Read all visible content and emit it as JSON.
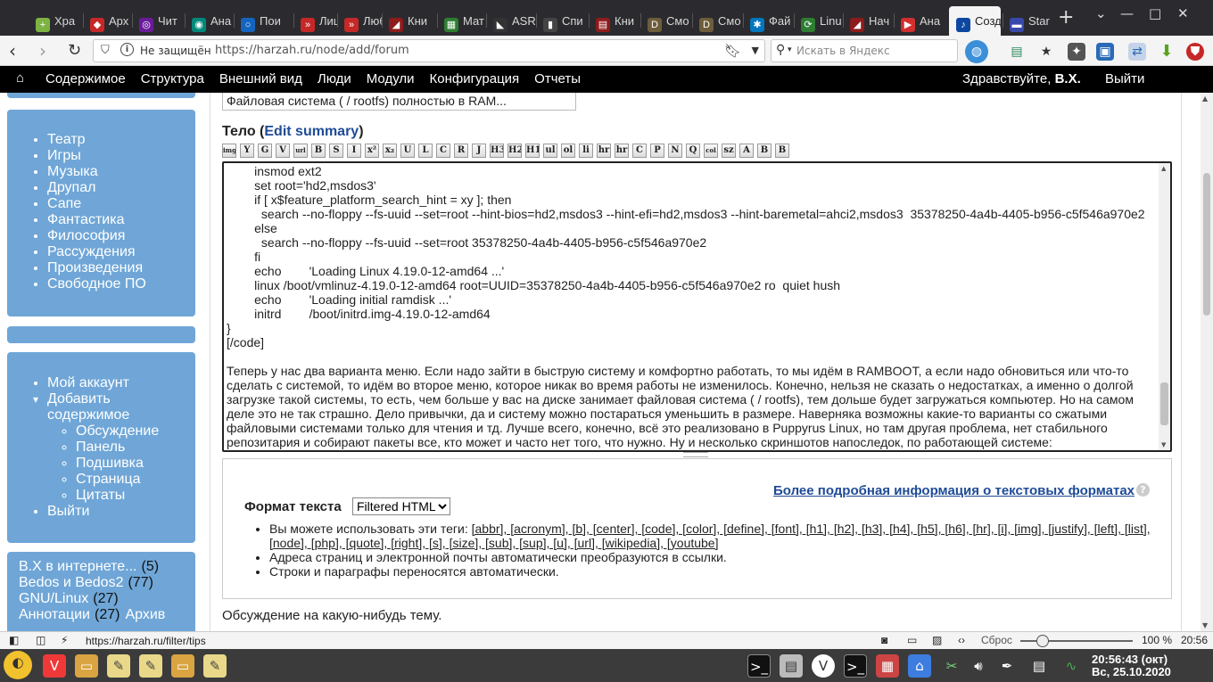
{
  "browser": {
    "tabs": [
      {
        "label": "Хра",
        "color": "#7cb342",
        "glyph": "+"
      },
      {
        "label": "Арх",
        "color": "#c62828",
        "glyph": "◆"
      },
      {
        "label": "Чит",
        "color": "#6a1b9a",
        "glyph": "◎"
      },
      {
        "label": "Ана",
        "color": "#00897b",
        "glyph": "◉"
      },
      {
        "label": "Пои",
        "color": "#1565c0",
        "glyph": "○"
      },
      {
        "label": "Лиц",
        "color": "#c62828",
        "glyph": "»"
      },
      {
        "label": "Люб",
        "color": "#c62828",
        "glyph": "»"
      },
      {
        "label": "Кни",
        "color": "#8e1b1b",
        "glyph": "◢"
      },
      {
        "label": "Мат",
        "color": "#2e7d32",
        "glyph": "▦"
      },
      {
        "label": "ASR",
        "color": "#333333",
        "glyph": "◣"
      },
      {
        "label": "Спи",
        "color": "#444444",
        "glyph": "▮"
      },
      {
        "label": "Кни",
        "color": "#8e1b1b",
        "glyph": "▤"
      },
      {
        "label": "Смо",
        "color": "#6d5d3a",
        "glyph": "D"
      },
      {
        "label": "Смо",
        "color": "#6d5d3a",
        "glyph": "D"
      },
      {
        "label": "Фай",
        "color": "#0277bd",
        "glyph": "✱"
      },
      {
        "label": "Linu",
        "color": "#2e7d32",
        "glyph": "⟳"
      },
      {
        "label": "Нач",
        "color": "#8e1b1b",
        "glyph": "◢"
      },
      {
        "label": "Ана",
        "color": "#d32f2f",
        "glyph": "▶"
      },
      {
        "label": "Созд",
        "color": "#0d47a1",
        "glyph": "♪",
        "active": true
      },
      {
        "label": "Star",
        "color": "#3949ab",
        "glyph": "▬"
      }
    ],
    "new_tab": "+",
    "security_label": "Не защищён",
    "url": "https://harzah.ru/node/add/forum",
    "search_placeholder": "Искать в Яндекс"
  },
  "admin_menu": {
    "items": [
      "Содержимое",
      "Структура",
      "Внешний вид",
      "Люди",
      "Модули",
      "Конфигурация",
      "Отчеты"
    ],
    "greeting": "Здравствуйте,",
    "username": "В.Х.",
    "logout": "Выйти"
  },
  "sidebar": {
    "categories": [
      "Театр",
      "Игры",
      "Музыка",
      "Друпал",
      "Сапе",
      "Фантастика",
      "Философия",
      "Рассуждения",
      "Произведения",
      "Свободное ПО"
    ],
    "user_menu": {
      "account": "Мой аккаунт",
      "add_content": "Добавить содержимое",
      "add_items": [
        "Обсуждение",
        "Панель",
        "Подшивка",
        "Страница",
        "Цитаты"
      ],
      "logout": "Выйти"
    },
    "tags": [
      {
        "name": "В.Х в интернете...",
        "count": "(5)"
      },
      {
        "name": "Bedos и Bedos2",
        "count": "(77)"
      },
      {
        "name": "GNU/Linux",
        "count": "(27)"
      },
      {
        "name": "Аннотации",
        "count": "(27)"
      },
      {
        "name": "Архив",
        "count": ""
      }
    ]
  },
  "form": {
    "title_value": "Файловая система ( / rootfs) полностью в RAM...",
    "body_label": "Тело (",
    "edit_summary": "Edit summary",
    "body_label_end": ")",
    "toolbar_buttons": [
      "img",
      "Y",
      "G",
      "V",
      "url",
      "B",
      "S",
      "I",
      "x²",
      "x₂",
      "U",
      "L",
      "C",
      "R",
      "J",
      "H3",
      "H2",
      "H1",
      "ul",
      "ol",
      "li",
      "hr",
      "hr",
      "C",
      "P",
      "N",
      "Q",
      "col",
      "sz",
      "A",
      "B",
      "B"
    ],
    "body_lines": [
      "        insmod ext2",
      "        set root='hd2,msdos3'",
      "        if [ x$feature_platform_search_hint = xy ]; then",
      "          search --no-floppy --fs-uuid --set=root --hint-bios=hd2,msdos3 --hint-efi=hd2,msdos3 --hint-baremetal=ahci2,msdos3  35378250-4a4b-4405-b956-c5f546a970e2",
      "        else",
      "          search --no-floppy --fs-uuid --set=root 35378250-4a4b-4405-b956-c5f546a970e2",
      "        fi",
      "        echo        'Loading Linux 4.19.0-12-amd64 ...'",
      "        linux /boot/vmlinuz-4.19.0-12-amd64 root=UUID=35378250-4a4b-4405-b956-c5f546a970e2 ro  quiet hush",
      "        echo        'Loading initial ramdisk ...'",
      "        initrd        /boot/initrd.img-4.19.0-12-amd64",
      "}",
      "[/code]",
      "",
      "Теперь у нас два варианта меню. Если надо зайти в быструю систему и комфортно работать, то мы идём в RAMBOOT, а если надо обновиться или что-то сделать с системой, то идём во второе меню, которое никак во время работы не изменилось. Конечно, нельзя не сказать о недостатках, а именно о долгой загрузке такой системы, то есть, чем больше у вас на диске занимает файловая система ( / rootfs), тем дольше будет загружаться компьютер. Но на самом деле это не так страшно. Дело привычки, да и систему можно постараться уменьшить в размере. Наверняка возможны какие-то варианты со сжатыми файловыми системами только для чтения и тд. Лучше всего, конечно, всё это реализовано в Puppyrus Linux, но там другая проблема, нет стабильного репозитария и собирают пакеты все, кто может и часто нет того, что нужно. Ну и несколько скриншотов напоследок, по работающей системе:"
    ],
    "formats_more": "Более подробная информация о текстовых форматах",
    "format_label": "Формат текста",
    "format_selected": "Filtered HTML",
    "tips_intro": "Вы можете использовать эти теги: ",
    "tips_tags": "[abbr], [acronym], [b], [center], [code], [color], [define], [font], [h1], [h2], [h3], [h4], [h5], [h6], [hr], [i], [img], [justify], [left], [list], [node], [php], [quote], [right], [s], [size], [sub], [sup], [u], [url], [wikipedia], [youtube]",
    "tip2": "Адреса страниц и электронной почты автоматически преобразуются в ссылки.",
    "tip3": "Строки и параграфы переносятся автоматически.",
    "description": "Обсуждение на какую-нибудь тему."
  },
  "statusbar": {
    "hover_url": "https://harzah.ru/filter/tips",
    "reset": "Сброс",
    "zoom": "100 %",
    "time": "20:56"
  },
  "taskbar": {
    "clock_line1": "20:56:43 (окт)",
    "clock_line2": "Вс, 25.10.2020"
  },
  "colors": {
    "tab_bar": "#2b2b2f",
    "admin_bar": "#000000",
    "sidebar_block": "#6fa6d7",
    "link": "#1f4b96",
    "taskbar": "#3b3b3b"
  }
}
